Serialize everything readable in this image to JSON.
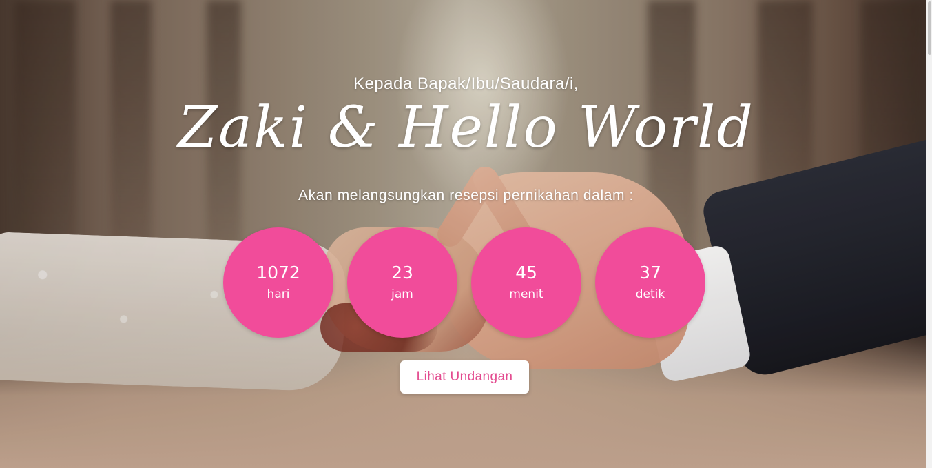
{
  "hero": {
    "greeting": "Kepada Bapak/Ibu/Saudara/i,",
    "names": "Zaki & Hello World",
    "subtitle": "Akan melangsungkan resepsi pernikahan dalam :"
  },
  "countdown": [
    {
      "value": "1072",
      "unit": "hari"
    },
    {
      "value": "23",
      "unit": "jam"
    },
    {
      "value": "45",
      "unit": "menit"
    },
    {
      "value": "37",
      "unit": "detik"
    }
  ],
  "cta": {
    "label": "Lihat Undangan"
  },
  "colors": {
    "accent": "#f14c9a",
    "button_text": "#e34b8f"
  }
}
